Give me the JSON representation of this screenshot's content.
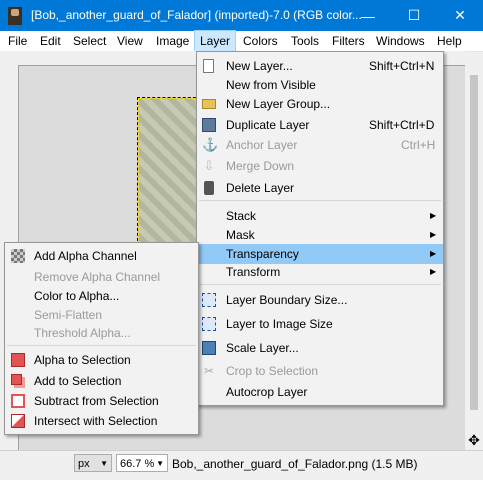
{
  "window": {
    "title": "[Bob,_another_guard_of_Falador] (imported)-7.0 (RGB color...",
    "minimize": "—",
    "maximize": "☐",
    "close": "✕"
  },
  "menubar": [
    "File",
    "Edit",
    "Select",
    "View",
    "Image",
    "Layer",
    "Colors",
    "Tools",
    "Filters",
    "Windows",
    "Help"
  ],
  "layer_menu": {
    "items": [
      {
        "label": "New Layer...",
        "shortcut": "Shift+Ctrl+N",
        "icon": "new-layer-icon",
        "disabled": false
      },
      {
        "label": "New from Visible",
        "shortcut": "",
        "icon": "",
        "disabled": false
      },
      {
        "label": "New Layer Group...",
        "shortcut": "",
        "icon": "folder-icon",
        "disabled": false
      },
      {
        "label": "Duplicate Layer",
        "shortcut": "Shift+Ctrl+D",
        "icon": "duplicate-layer-icon",
        "disabled": false
      },
      {
        "label": "Anchor Layer",
        "shortcut": "Ctrl+H",
        "icon": "anchor-icon",
        "disabled": true
      },
      {
        "label": "Merge Down",
        "shortcut": "",
        "icon": "merge-down-icon",
        "disabled": true
      },
      {
        "label": "Delete Layer",
        "shortcut": "",
        "icon": "delete-icon",
        "disabled": false
      },
      {
        "label": "Stack",
        "submenu": true
      },
      {
        "label": "Mask",
        "submenu": true
      },
      {
        "label": "Transparency",
        "submenu": true,
        "highlighted": true
      },
      {
        "label": "Transform",
        "submenu": true
      },
      {
        "label": "Layer Boundary Size...",
        "icon": "layer-boundary-icon"
      },
      {
        "label": "Layer to Image Size",
        "icon": "layer-to-image-icon"
      },
      {
        "label": "Scale Layer...",
        "icon": "scale-layer-icon"
      },
      {
        "label": "Crop to Selection",
        "icon": "crop-icon",
        "disabled": true
      },
      {
        "label": "Autocrop Layer",
        "icon": ""
      }
    ]
  },
  "transparency_menu": {
    "items": [
      {
        "label": "Add Alpha Channel",
        "icon": "alpha-channel-icon",
        "disabled": false
      },
      {
        "label": "Remove Alpha Channel",
        "disabled": true
      },
      {
        "label": "Color to Alpha...",
        "disabled": false
      },
      {
        "label": "Semi-Flatten",
        "disabled": true
      },
      {
        "label": "Threshold Alpha...",
        "disabled": true
      },
      {
        "label": "Alpha to Selection",
        "icon": "alpha-to-selection-icon"
      },
      {
        "label": "Add to Selection",
        "icon": "add-to-selection-icon"
      },
      {
        "label": "Subtract from Selection",
        "icon": "subtract-from-selection-icon"
      },
      {
        "label": "Intersect with Selection",
        "icon": "intersect-with-selection-icon"
      }
    ]
  },
  "statusbar": {
    "unit": "px",
    "zoom": "66.7 %",
    "info": "Bob,_another_guard_of_Falador.png (1.5 MB)"
  },
  "colors": {
    "titlebar": "#0078d7",
    "highlight": "#91c9f7",
    "menubar_active": "#cce8ff"
  }
}
